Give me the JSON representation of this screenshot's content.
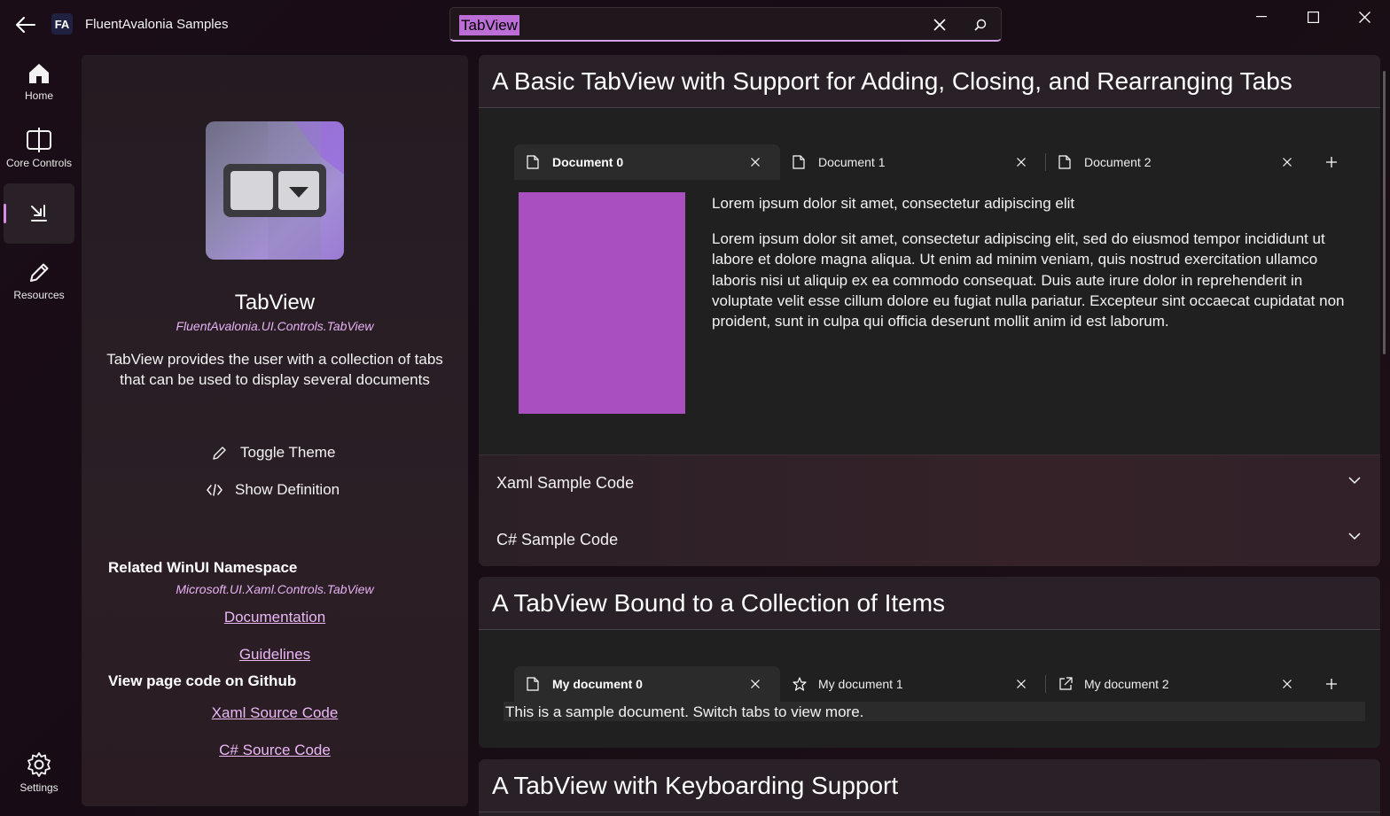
{
  "titlebar": {
    "app_title": "FluentAvalonia Samples",
    "logo_text": "FA",
    "search_value": "TabView",
    "accent": "#d3a0e6"
  },
  "nav": {
    "items": [
      {
        "label": "Home",
        "icon": "home-icon"
      },
      {
        "label": "Core Controls",
        "icon": "core-controls-icon"
      },
      {
        "label": "",
        "icon": "new-controls-icon"
      },
      {
        "label": "Resources",
        "icon": "pencil-icon"
      }
    ],
    "settings_label": "Settings"
  },
  "info": {
    "control_name": "TabView",
    "namespace": "FluentAvalonia.UI.Controls.TabView",
    "description": "TabView provides the user with a collection of tabs that can be used to display several documents",
    "toggle_theme": "Toggle Theme",
    "show_definition": "Show Definition",
    "related_title": "Related WinUI Namespace",
    "related_namespace": "Microsoft.UI.Xaml.Controls.TabView",
    "documentation_link": "Documentation",
    "guidelines_link": "Guidelines",
    "github_title": "View page code on Github",
    "xaml_source_link": "Xaml Source Code",
    "cs_source_link": "C# Source Code"
  },
  "card1": {
    "title": "A Basic TabView with Support for Adding, Closing, and Rearranging Tabs",
    "tabs": [
      "Document 0",
      "Document 1",
      "Document 2"
    ],
    "heading": "Lorem ipsum dolor sit amet, consectetur adipiscing elit",
    "paragraph": "Lorem ipsum dolor sit amet, consectetur adipiscing elit, sed do eiusmod tempor incididunt ut labore et dolore magna aliqua. Ut enim ad minim veniam, quis nostrud exercitation ullamco laboris nisi ut aliquip ex ea commodo consequat. Duis aute irure dolor in reprehenderit in voluptate velit esse cillum dolore eu fugiat nulla pariatur. Excepteur sint occaecat cupidatat non proident, sunt in culpa qui officia deserunt mollit anim id est laborum.",
    "swatch_color": "#a94fc0",
    "xaml_expander": "Xaml Sample Code",
    "cs_expander": "C# Sample Code"
  },
  "card2": {
    "title": "A TabView Bound to a Collection of Items",
    "tabs": [
      "My document 0",
      "My document 1",
      "My document 2"
    ],
    "content": "This is a sample document. Switch tabs to view more."
  },
  "card3": {
    "title": "A TabView with Keyboarding Support"
  }
}
